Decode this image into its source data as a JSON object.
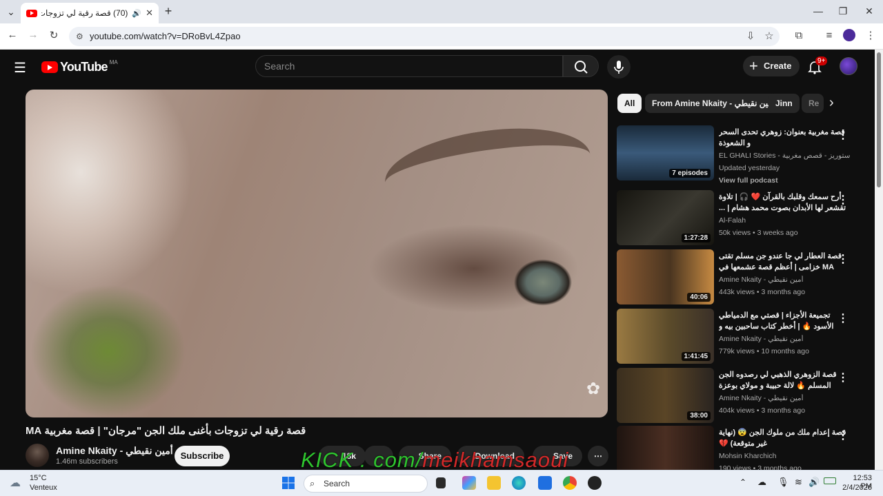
{
  "browser": {
    "tab_title": "(70) قصة رقية لي تزوجات بأغ",
    "url": "youtube.com/watch?v=DRoBvL4Zpao",
    "new_tab": "+",
    "tab_close": "✕"
  },
  "header": {
    "logo_text": "YouTube",
    "country_code": "MA",
    "search_placeholder": "Search",
    "create_label": "Create",
    "notification_badge": "9+"
  },
  "video": {
    "title": "قصة رقية لي تزوجات بأغنى ملك الجن \"مرجان\" | قصة مغربية MA",
    "channel": "Amine Nkaity - أمين نقيطي",
    "subscribers": "1.46m subscribers",
    "subscribe_label": "Subscribe",
    "likes": "18k",
    "share_label": "Share",
    "download_label": "Download",
    "save_label": "Save"
  },
  "overlay": {
    "kick_text": "KICK . com/",
    "name_text": "meikhamsaoui"
  },
  "chips": [
    "All",
    "From Amine Nkaity - أمين نقيطي",
    "Jinn",
    "Re"
  ],
  "recommendations": [
    {
      "title": "قصة مغربية بعنوان: زوهري تحدى السحر و الشعوذة",
      "channel": "EL GHALI Stories - الغالي ستوريز - قصص مغربية",
      "line1": "Updated yesterday",
      "line2": "View full podcast",
      "badge": "7 episodes",
      "color": "#3a5a7a"
    },
    {
      "title": "أرح سمعك وقلبك بالقرآن ❤️ 🎧 | تلاوة تقشعر لها الأبدان بصوت محمد هشام | ...",
      "channel": "Al-Falah",
      "line1": "50k views • 3 weeks ago",
      "badge": "1:27:28",
      "color": "#2c2b26"
    },
    {
      "title": "قصة العطار لي جا عندو جن مسلم تقتى MA خزامى | أعظم قصة عشمعها في حياتك ...",
      "channel": "Amine Nkaity - أمين نقيطي",
      "line1": "443k views • 3 months ago",
      "badge": "40:06",
      "color": "#6a4a2e"
    },
    {
      "title": "تجميعة الأجزاء | قصتي مع الدمياطي الأسود 🔥 | أخطر كتاب ساحبين بيه و ماعارفين ...",
      "channel": "Amine Nkaity - أمين نقيطي",
      "line1": "779k views • 10 months ago",
      "badge": "1:41:45",
      "color": "#7a5a32"
    },
    {
      "title": "قصة الزوهري الذهبي لي رصدوه الجن المسلم 🔥 لالة حبيبة و مولاي بوعزة",
      "channel": "Amine Nkaity - أمين نقيطي",
      "line1": "404k views • 3 months ago",
      "badge": "38:00",
      "color": "#4a3a22"
    },
    {
      "title": "قصة إعدام ملك من ملوك الجن 😨 (نهاية غير متوقعة) 💔",
      "channel": "Mohsin Kharchich",
      "line1": "190 views • 3 months ago",
      "badge": "",
      "color": "#3a2a22"
    }
  ],
  "taskbar": {
    "weather_temp": "15°C",
    "weather_desc": "Venteux",
    "search_label": "Search",
    "time": "12:53 PM",
    "date": "2/4/2026"
  }
}
